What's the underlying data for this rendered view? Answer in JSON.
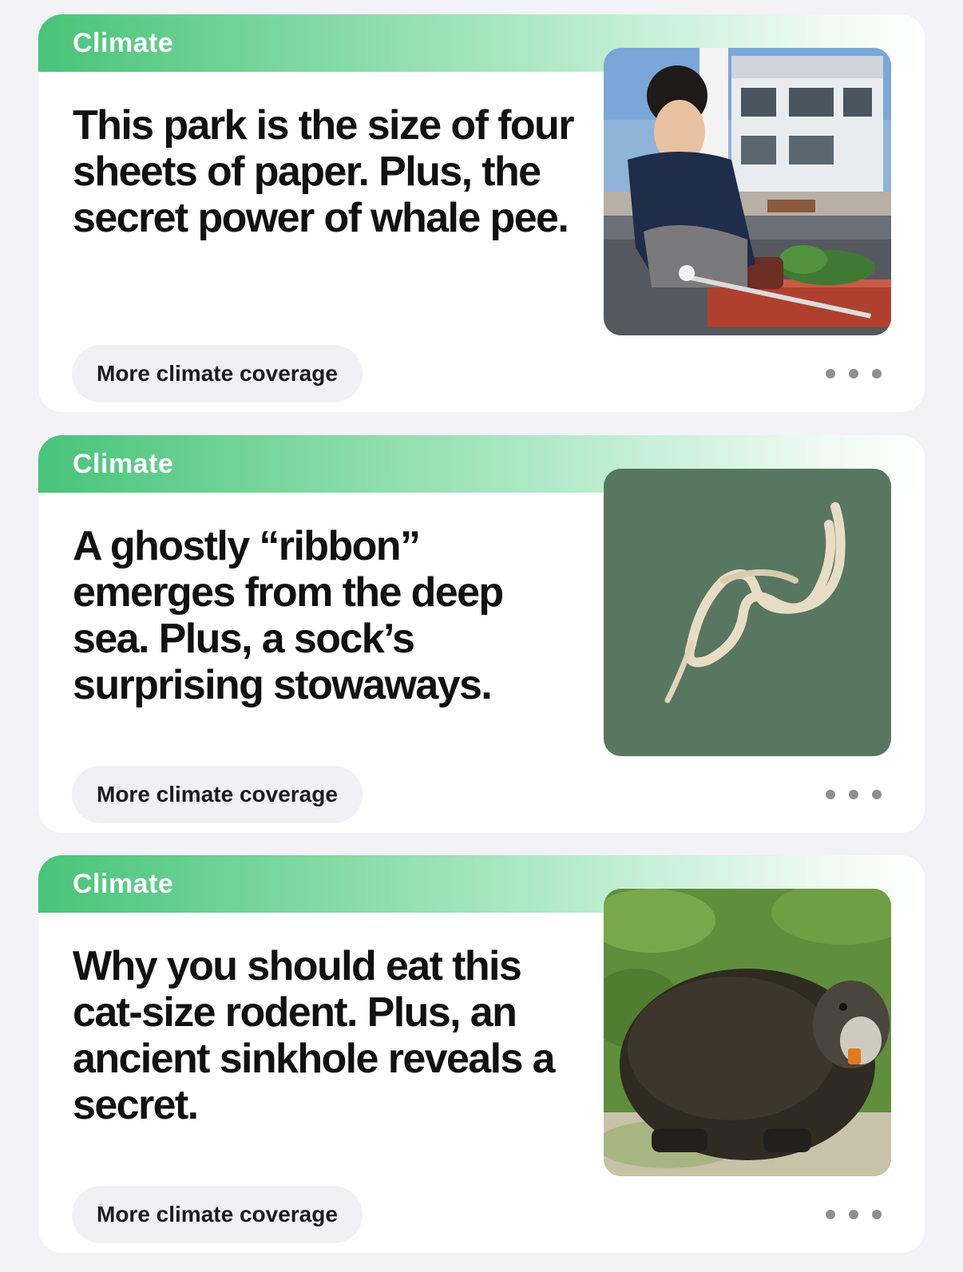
{
  "accent_color": "#48c47a",
  "stories": [
    {
      "topic": "Climate",
      "headline": "This park is the size of four sheets of paper. Plus, the secret power of whale pee.",
      "button_label": "More climate coverage",
      "menu_icon": "ellipsis-icon"
    },
    {
      "topic": "Climate",
      "headline": "A ghostly “ribbon” emerges from the deep sea. Plus, a sock’s surprising stowaways.",
      "button_label": "More climate coverage",
      "menu_icon": "ellipsis-icon"
    },
    {
      "topic": "Climate",
      "headline": "Why you should eat this cat-size rodent. Plus, an ancient sinkhole reveals a secret.",
      "button_label": "More climate coverage",
      "menu_icon": "ellipsis-icon"
    }
  ]
}
